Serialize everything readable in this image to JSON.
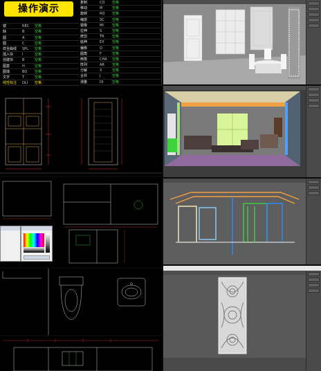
{
  "title": "操作演示",
  "commands_left": [
    {
      "name": "",
      "key": "",
      "action": ""
    },
    {
      "name": "镜",
      "key": "REC",
      "action": "空格"
    },
    {
      "name": "缺",
      "key": "B",
      "action": "空格"
    },
    {
      "name": "圆",
      "key": "A",
      "action": "空格"
    },
    {
      "name": "圆",
      "key": "C",
      "action": "空格"
    },
    {
      "name": "样全曲线",
      "key": "SPL",
      "action": "空格"
    },
    {
      "name": "插入块",
      "key": "I",
      "action": "空格"
    },
    {
      "name": "创建块",
      "key": "B",
      "action": "空格"
    },
    {
      "name": "图案",
      "key": "H",
      "action": "空格"
    },
    {
      "name": "图填",
      "key": "BO",
      "action": "空格"
    },
    {
      "name": "文字",
      "key": "T",
      "action": "空格"
    },
    {
      "name": "线性标注",
      "key": "DLI",
      "action": "空格"
    },
    {
      "name": "连续标注",
      "key": "DCO",
      "action": "空格"
    }
  ],
  "commands_right": [
    {
      "name": "复制",
      "key": "CO",
      "action": "空格"
    },
    {
      "name": "移动",
      "key": "M",
      "action": "空格"
    },
    {
      "name": "旋转",
      "key": "RO",
      "action": "空格"
    },
    {
      "name": "缩放",
      "key": "SC",
      "action": "空格"
    },
    {
      "name": "镜像",
      "key": "MI",
      "action": "空格"
    },
    {
      "name": "拉伸",
      "key": "S",
      "action": "空格"
    },
    {
      "name": "修剪",
      "key": "TR",
      "action": "空格"
    },
    {
      "name": "延伸",
      "key": "EX",
      "action": "空格"
    },
    {
      "name": "偏移",
      "key": "O",
      "action": "空格"
    },
    {
      "name": "圆角",
      "key": "F",
      "action": "空格"
    },
    {
      "name": "倒角",
      "key": "CHA",
      "action": "空格"
    },
    {
      "name": "阵列",
      "key": "AR",
      "action": "空格"
    },
    {
      "name": "分解",
      "key": "X",
      "action": "空格"
    },
    {
      "name": "合并",
      "key": "J",
      "action": "空格"
    },
    {
      "name": "测量",
      "key": "DI",
      "action": "空格"
    }
  ],
  "colors": {
    "title_bg": "#ffe400",
    "cad_bg": "#000000",
    "max_bg": "#3d3d3d",
    "accent_green": "#3fd23f"
  }
}
